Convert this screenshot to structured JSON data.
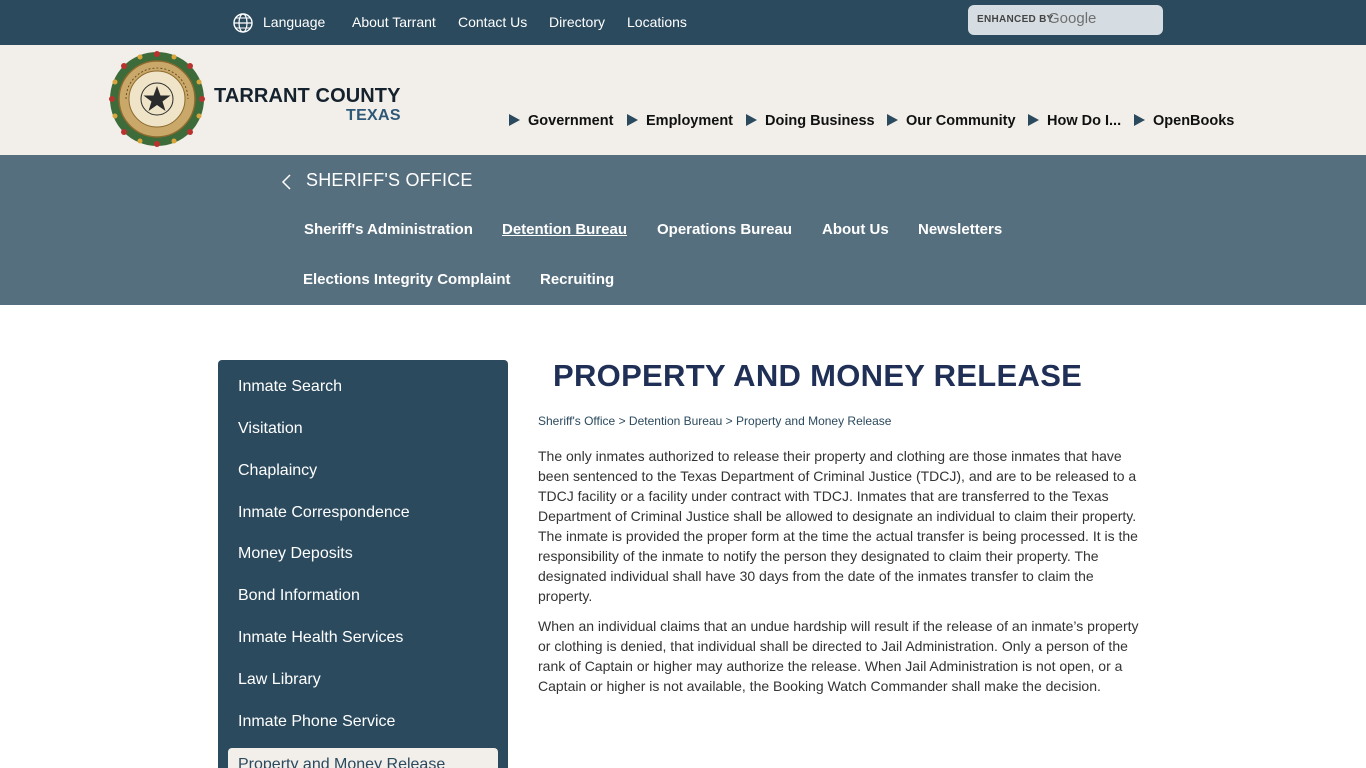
{
  "topbar": {
    "language_label": "Language",
    "links": [
      "About Tarrant",
      "Contact Us",
      "Directory",
      "Locations"
    ],
    "search": {
      "enhanced_label": "ENHANCED BY",
      "provider": "Google"
    }
  },
  "header": {
    "county_name": "TARRANT COUNTY",
    "state": "TEXAS",
    "seal_text": "TARRANT COUNTY TEXAS",
    "nav": [
      "Government",
      "Employment",
      "Doing Business",
      "Our Community",
      "How Do I...",
      "OpenBooks"
    ]
  },
  "department": {
    "title": "SHERIFF'S OFFICE",
    "links_row1": [
      "Sheriff's Administration",
      "Detention Bureau",
      "Operations Bureau",
      "About Us",
      "Newsletters"
    ],
    "links_row2": [
      "Elections Integrity Complaint",
      "Recruiting"
    ],
    "active": "Detention Bureau"
  },
  "sidebar": {
    "items": [
      "Inmate Search",
      "Visitation",
      "Chaplaincy",
      "Inmate Correspondence",
      "Money Deposits",
      "Bond Information",
      "Inmate Health Services",
      "Law Library",
      "Inmate Phone Service"
    ],
    "current": "Property and Money Release"
  },
  "content": {
    "title": "PROPERTY AND MONEY RELEASE",
    "breadcrumb": [
      "Sheriff's Office",
      "Detention Bureau",
      "Property and Money Release"
    ],
    "breadcrumb_sep": ">",
    "paragraphs": [
      "The only inmates authorized to release their property and clothing are those inmates that have been sentenced to the Texas Department of Criminal Justice (TDCJ), and are to be released to a TDCJ facility or a facility under contract with TDCJ.  Inmates that are transferred to the Texas Department of Criminal Justice shall be allowed to designate an individual to claim their property. The inmate is provided the proper form at the time the actual transfer is being processed. It is the responsibility of the inmate to notify the person they designated to claim their property. The designated individual shall have 30 days from the date of the inmates transfer to claim the property.",
      "When an individual claims that an undue hardship will result if the release of an inmate’s property or clothing is denied, that individual shall be directed to Jail Administration. Only a person of the rank of Captain or higher may authorize the release. When Jail Administration is not open, or a Captain or higher is not available, the Booking Watch Commander shall make the decision."
    ]
  },
  "colors": {
    "topbar": "#2b4a5e",
    "header_bg": "#f2efea",
    "dept_band": "#566f7f",
    "sidebar": "#2b4a5e",
    "title": "#1f2f56"
  }
}
